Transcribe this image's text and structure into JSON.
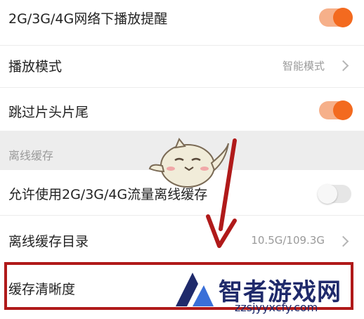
{
  "settings": {
    "row1": {
      "label": "2G/3G/4G网络下播放提醒",
      "toggle": "on"
    },
    "row2": {
      "label": "播放模式",
      "value": "智能模式"
    },
    "row3": {
      "label": "跳过片头片尾",
      "toggle": "on"
    },
    "section": {
      "label": "离线缓存"
    },
    "row4": {
      "label": "允许使用2G/3G/4G流量离线缓存",
      "toggle": "off"
    },
    "row5": {
      "label": "离线缓存目录",
      "value": "10.5G/109.3G"
    },
    "row6": {
      "label": "缓存清晰度"
    }
  },
  "watermark": {
    "text": "智者游戏网",
    "url": "zzsjyyxcfy.com"
  },
  "colors": {
    "accent": "#f36a1f",
    "highlight": "#b01a1a",
    "section_bg": "#ededed",
    "watermark": "#1f2a6b"
  },
  "icons": [
    "chevron-right-icon",
    "toggle-switch",
    "mascot-sticker",
    "arrow-icon",
    "watermark-logo"
  ]
}
